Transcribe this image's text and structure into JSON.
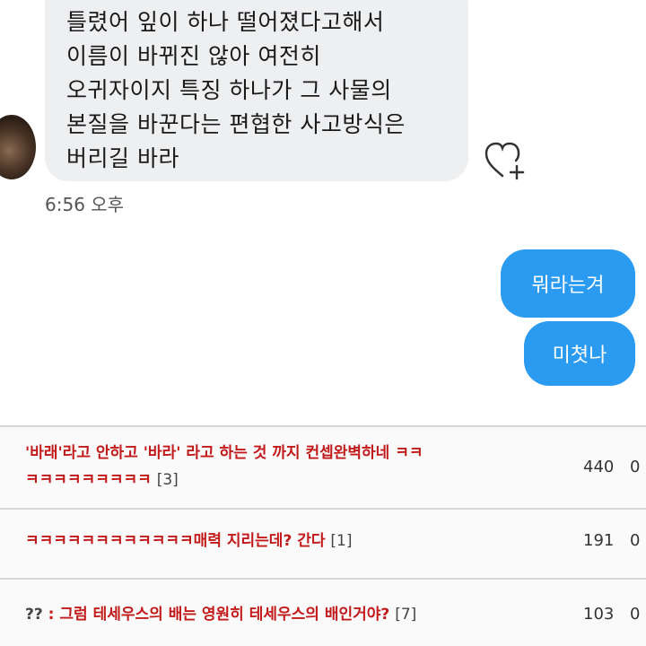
{
  "chat": {
    "incoming_message_lines": [
      "틀렸어 잎이 하나 떨어졌다고해서",
      "이름이 바뀌진 않아 여전히",
      "오귀자이지 특징 하나가 그 사물의",
      "본질을 바꾼다는 편협한 사고방식은",
      "버리길 바라"
    ],
    "incoming_timestamp": "6:56 오후",
    "outgoing_messages": [
      "뭐라는겨",
      "미쳣나"
    ],
    "heart_icon": "heart-plus-icon",
    "colors": {
      "incoming_bubble": "#eeeff1",
      "outgoing_bubble": "#2a9bf1"
    }
  },
  "comments": [
    {
      "line1": "'바래'라고 안하고 '바라' 라고 하는 것 까지 컨셉완벽하네 ㅋㅋ",
      "line2": "ㅋㅋㅋㅋㅋㅋㅋㅋㅋ",
      "reply_count": "[3]",
      "votes": "440",
      "downvotes": "0"
    },
    {
      "line1": "ㅋㅋㅋㅋㅋㅋㅋㅋㅋㅋㅋㅋ매력 지리는데? 간다",
      "reply_count": "[1]",
      "votes": "191",
      "downvotes": "0"
    },
    {
      "prefix": "??",
      "line1": ": 그럼 테세우스의 배는 영원히 테세우스의 배인거야?",
      "reply_count": "[7]",
      "votes": "103",
      "downvotes": "0"
    }
  ],
  "colors": {
    "comment_text": "#c21a1a"
  }
}
